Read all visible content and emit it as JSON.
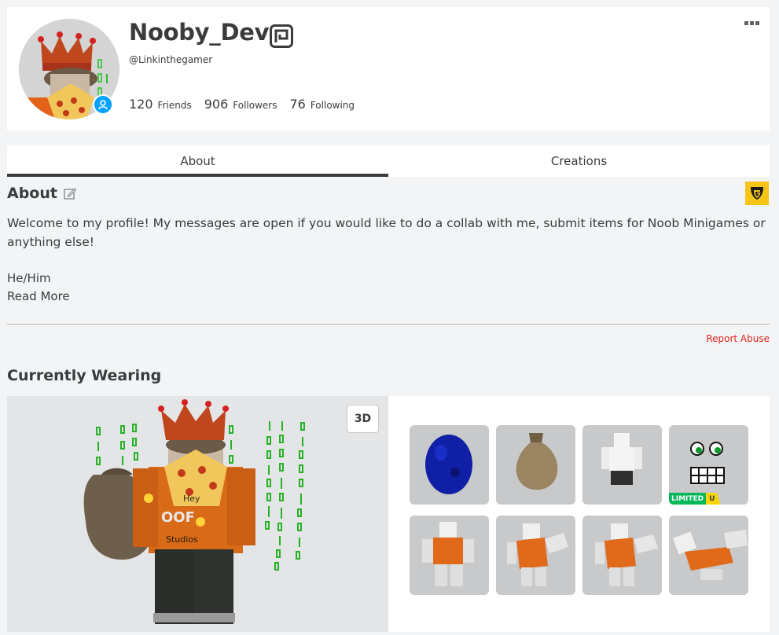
{
  "profile": {
    "display_name": "Nooby_Dev",
    "username": "@Linkinthegamer",
    "verified_icon": "verified-badge-icon",
    "presence_icon": "online-presence-icon"
  },
  "stats": [
    {
      "count": "120",
      "label": "Friends"
    },
    {
      "count": "906",
      "label": "Followers"
    },
    {
      "count": "76",
      "label": "Following"
    }
  ],
  "tabs": [
    {
      "label": "About",
      "active": true
    },
    {
      "label": "Creations",
      "active": false
    }
  ],
  "about": {
    "title": "About",
    "description": "Welcome to my profile! My messages are open if you would like to do a collab with me, submit items for Noob Minigames or anything else!",
    "pronouns": "He/Him",
    "read_more": "Read More",
    "report_abuse": "Report Abuse"
  },
  "wearing": {
    "title": "Currently Wearing",
    "toggle_3d": "3D",
    "avatar_shirt_lines": [
      "Hey",
      "OOF",
      "Studios"
    ],
    "items": [
      {
        "icon": "blue-egg-icon"
      },
      {
        "icon": "sack-bag-icon"
      },
      {
        "icon": "white-shirt-icon"
      },
      {
        "icon": "face-icon",
        "badge_limited": "LIMITED",
        "badge_u": "U"
      },
      {
        "icon": "orange-torso-icon"
      },
      {
        "icon": "orange-arm-left-icon"
      },
      {
        "icon": "orange-arm-right-icon"
      },
      {
        "icon": "orange-leg-icon"
      }
    ]
  },
  "colors": {
    "accent_blue": "#00a2ff",
    "report_red": "#e2231a",
    "guilded_yellow": "#f5c518",
    "limited_green": "#02b757"
  }
}
